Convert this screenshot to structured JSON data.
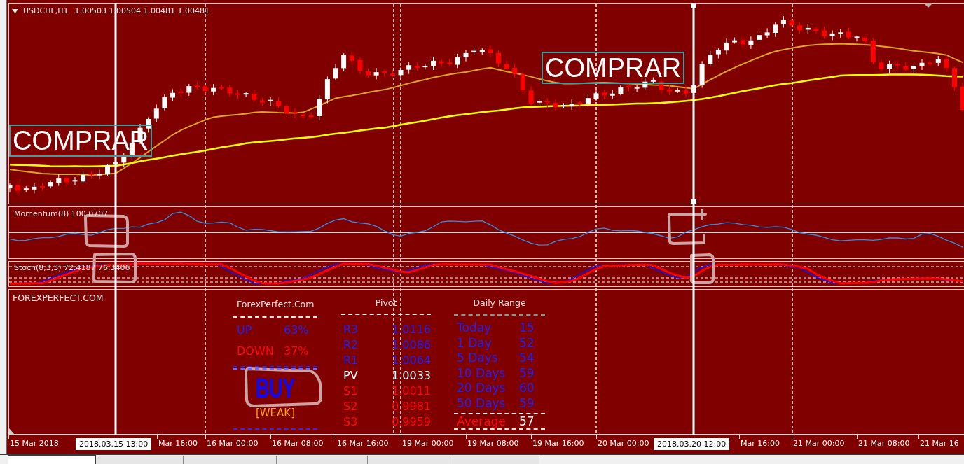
{
  "chart": {
    "symbol": "USDCHF,H1",
    "prices": "1.00503 1.00504 1.00481 1.00481",
    "signals": [
      {
        "text": "COMPRAR"
      },
      {
        "text": "COMPRAR"
      }
    ]
  },
  "vertical_lines": [
    {
      "time_label": "2018.03.15 13:00",
      "selected": false
    },
    {
      "time_label": "2018.03.20 12:00",
      "selected": true
    }
  ],
  "momentum": {
    "label": "Momentum(8) 100.0707"
  },
  "stochastic": {
    "label": "Stoch(8,3,3) 72.4187 76.3406"
  },
  "forexperfect": {
    "label": "FOREXPERFECT.COM",
    "summary": {
      "title": "ForexPerfect.Com",
      "rows": [
        {
          "kind": "up",
          "label": "UP",
          "value": "63%"
        },
        {
          "kind": "down",
          "label": "DOWN",
          "value": "37%"
        }
      ],
      "signal": "BUY",
      "strength": "[WEAK]"
    },
    "pivot": {
      "title": "Pivot",
      "levels": [
        {
          "kind": "resistance",
          "label": "R3",
          "value": "1.0116"
        },
        {
          "kind": "resistance",
          "label": "R2",
          "value": "1.0086"
        },
        {
          "kind": "resistance",
          "label": "R1",
          "value": "1.0064"
        },
        {
          "kind": "pivot",
          "label": "PV",
          "value": "1.0033"
        },
        {
          "kind": "support",
          "label": "S1",
          "value": "1.0011"
        },
        {
          "kind": "support",
          "label": "S2",
          "value": "0.9981"
        },
        {
          "kind": "support",
          "label": "S3",
          "value": "0.9959"
        }
      ]
    },
    "daily_range": {
      "title": "Daily Range",
      "rows": [
        {
          "label": "Today",
          "value": "15"
        },
        {
          "label": "1 Day",
          "value": "52"
        },
        {
          "label": "5 Days",
          "value": "54"
        },
        {
          "label": "10 Days",
          "value": "59"
        },
        {
          "label": "20 Days",
          "value": "60"
        },
        {
          "label": "50 Days",
          "value": "59"
        }
      ],
      "average": {
        "label": "Average",
        "value": "57"
      }
    }
  },
  "time_axis": {
    "labels": [
      "15 Mar 2018",
      "Mar 16:00",
      "16 Mar 00:00",
      "16 Mar 08:00",
      "16 Mar 16:00",
      "19 Mar 00:00",
      "19 Mar 08:00",
      "19 Mar 16:00",
      "20 Mar 00:00",
      "Mar 16:00",
      "21 Mar 00:00",
      "21 Mar 08:00",
      "21 Mar 16"
    ]
  },
  "tabs": [
    {
      "selected": true
    },
    {
      "selected": false
    },
    {
      "selected": false
    },
    {
      "selected": false
    },
    {
      "selected": false
    },
    {
      "selected": false
    }
  ]
}
